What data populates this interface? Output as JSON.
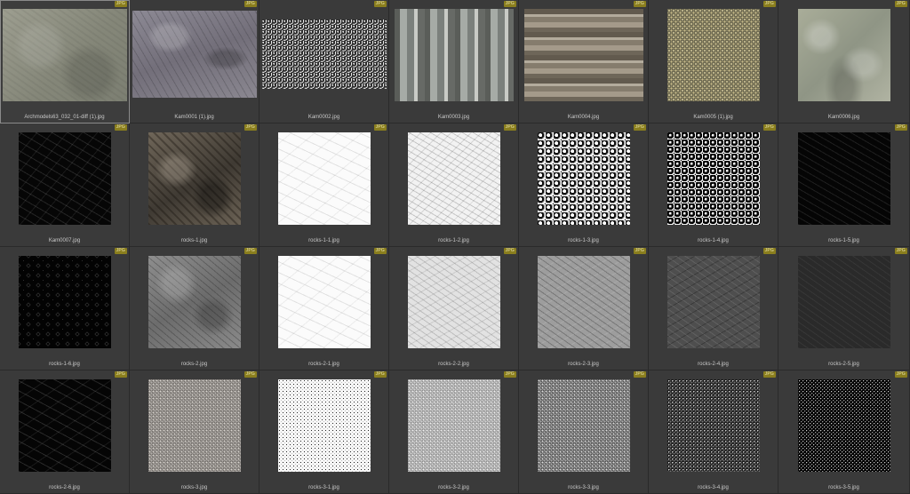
{
  "badge_label": "JPG",
  "tiles": [
    {
      "name": "Archmodels63_032_01-diff (1).jpg",
      "texture": "concrete",
      "selected": true,
      "shape": "wide"
    },
    {
      "name": "Kam0001 (1).jpg",
      "texture": "rock-grey",
      "shape": "wide2"
    },
    {
      "name": "Kam0002.jpg",
      "texture": "gravel-dense",
      "shape": "wide3"
    },
    {
      "name": "Kam0003.jpg",
      "texture": "stripes",
      "shape": "tall"
    },
    {
      "name": "Kam0004.jpg",
      "texture": "layers",
      "shape": "tall"
    },
    {
      "name": "Kam0005 (1).jpg",
      "texture": "pebbles",
      "shape": "square"
    },
    {
      "name": "Kam0006.jpg",
      "texture": "swirl",
      "shape": "square"
    },
    {
      "name": "Kam0007.jpg",
      "texture": "black-sparse",
      "shape": "square"
    },
    {
      "name": "rocks-1.jpg",
      "texture": "rock-brown",
      "shape": "square"
    },
    {
      "name": "rocks-1-1.jpg",
      "texture": "white-lines",
      "shape": "square"
    },
    {
      "name": "rocks-1-2.jpg",
      "texture": "white-rock",
      "shape": "square"
    },
    {
      "name": "rocks-1-3.jpg",
      "texture": "highcontrast",
      "shape": "square"
    },
    {
      "name": "rocks-1-4.jpg",
      "texture": "black-white",
      "shape": "square"
    },
    {
      "name": "rocks-1-5.jpg",
      "texture": "near-black",
      "shape": "square"
    },
    {
      "name": "rocks-1-6.jpg",
      "texture": "black-dots",
      "shape": "square"
    },
    {
      "name": "rocks-2.jpg",
      "texture": "grey-rock",
      "shape": "square"
    },
    {
      "name": "rocks-2-1.jpg",
      "texture": "white-lines",
      "shape": "square"
    },
    {
      "name": "rocks-2-2.jpg",
      "texture": "light-rock",
      "shape": "square"
    },
    {
      "name": "rocks-2-3.jpg",
      "texture": "mid-rock",
      "shape": "square"
    },
    {
      "name": "rocks-2-4.jpg",
      "texture": "dark-rock",
      "shape": "square"
    },
    {
      "name": "rocks-2-5.jpg",
      "texture": "darker-rock",
      "shape": "square"
    },
    {
      "name": "rocks-2-6.jpg",
      "texture": "black-streak",
      "shape": "square"
    },
    {
      "name": "rocks-3.jpg",
      "texture": "noise-color",
      "shape": "square"
    },
    {
      "name": "rocks-3-1.jpg",
      "texture": "noise-white",
      "shape": "square"
    },
    {
      "name": "rocks-3-2.jpg",
      "texture": "noise-light",
      "shape": "square"
    },
    {
      "name": "rocks-3-3.jpg",
      "texture": "noise-mid",
      "shape": "square"
    },
    {
      "name": "rocks-3-4.jpg",
      "texture": "noise-dark",
      "shape": "square"
    },
    {
      "name": "rocks-3-5.jpg",
      "texture": "noise-black",
      "shape": "square"
    }
  ],
  "colors": {
    "background": "#303030",
    "tile": "#3a3a3a",
    "badge": "#8a7e1e",
    "caption": "#c8c8c8"
  }
}
